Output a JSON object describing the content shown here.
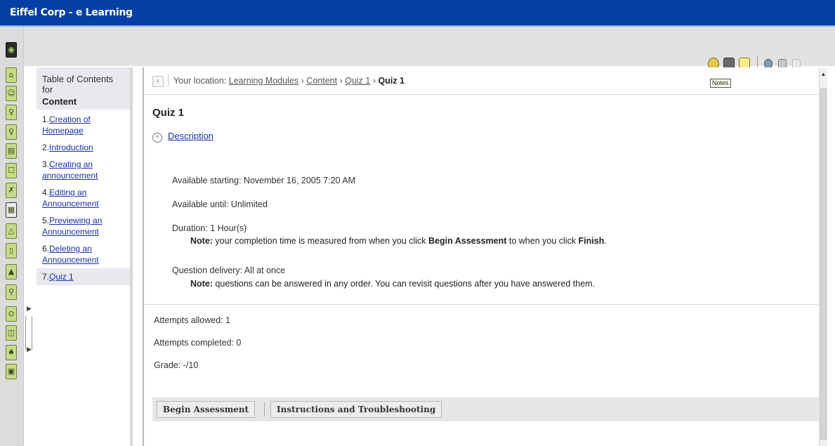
{
  "window": {
    "title": "Eiffel Corp - e Learning"
  },
  "toc": {
    "heading": "Table of Contents for",
    "section": "Content",
    "items": [
      {
        "num": "1.",
        "label": "Creation of Homepage"
      },
      {
        "num": "2.",
        "label": "Introduction"
      },
      {
        "num": "3.",
        "label": "Creating an announcement"
      },
      {
        "num": "4.",
        "label": "Editing an Announcement"
      },
      {
        "num": "5.",
        "label": "Previewing an Announcement"
      },
      {
        "num": "6.",
        "label": "Deleting an Announcement"
      },
      {
        "num": "7.",
        "label": "Quiz 1"
      }
    ],
    "selected_index": 6
  },
  "location": {
    "prefix": "Your location:",
    "crumbs": [
      "Learning Modules",
      "Content",
      "Quiz 1"
    ],
    "current": "Quiz 1",
    "separator": "›"
  },
  "tooltip": {
    "notes": "Notes"
  },
  "quiz": {
    "title": "Quiz 1",
    "description_link": "Description",
    "available_starting": "Available starting: November 16, 2005 7:20 AM",
    "available_until": "Available until: Unlimited",
    "duration": "Duration: 1 Hour(s)",
    "duration_note": {
      "label": "Note:",
      "p1": " your completion time is measured from when you click ",
      "b1": "Begin Assessment",
      "p2": " to when you click ",
      "b2": "Finish",
      "p3": "."
    },
    "question_delivery": "Question delivery: All at once",
    "delivery_note": {
      "label": "Note:",
      "text": " questions can be answered in any order. You can revisit questions after you have answered them."
    },
    "attempts_allowed": "Attempts allowed: 1",
    "attempts_completed": "Attempts completed: 0",
    "grade": "Grade: -/10"
  },
  "buttons": {
    "begin": "Begin Assessment",
    "instructions": "Instructions and Troubleshooting"
  },
  "icons": {
    "left_strip": [
      "home-icon",
      "discussion-icon",
      "people-icon",
      "search-user-icon",
      "notes-icon",
      "chat-icon",
      "pin-icon",
      "content-icon",
      "bell-icon",
      "document-icon",
      "lock-icon",
      "magnifier-icon",
      "clock-icon",
      "copy-icon",
      "tools-icon",
      "profile-icon"
    ],
    "toolbar": [
      "help-icon",
      "print-icon",
      "notes-icon",
      "person-icon",
      "lock-icon",
      "unlink-icon"
    ]
  },
  "colors": {
    "titlebar": "#063ea6",
    "link": "#1a2fa8"
  }
}
